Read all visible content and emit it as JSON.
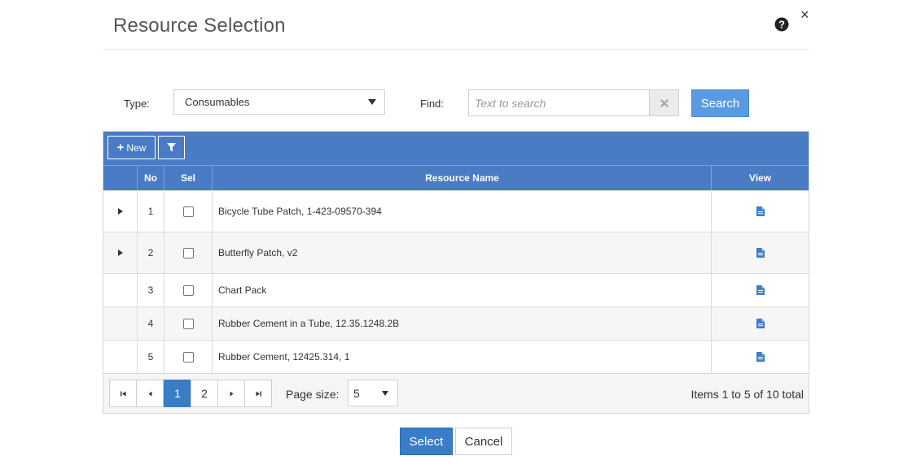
{
  "dialog": {
    "title": "Resource Selection",
    "help_icon": "question-circle-icon",
    "close_icon": "close-icon",
    "close_glyph": "×"
  },
  "filters": {
    "type_label": "Type:",
    "type_value": "Consumables",
    "find_label": "Find:",
    "search_placeholder": "Text to search",
    "search_value": "",
    "clear_icon": "clear-x-icon",
    "search_label": "Search"
  },
  "toolbar": {
    "new_label": "New",
    "new_icon": "plus-icon",
    "filter_icon": "filter-icon"
  },
  "grid": {
    "columns": [
      "",
      "No",
      "Sel",
      "Resource Name",
      "View"
    ],
    "rows": [
      {
        "no": "1",
        "name": "Bicycle Tube Patch, 1-423-09570-394",
        "expandable": true,
        "checked": false
      },
      {
        "no": "2",
        "name": "Butterfly Patch, v2",
        "expandable": true,
        "checked": false
      },
      {
        "no": "3",
        "name": "Chart Pack",
        "expandable": false,
        "checked": false
      },
      {
        "no": "4",
        "name": "Rubber Cement in a Tube, 12.35.1248.2B",
        "expandable": false,
        "checked": false
      },
      {
        "no": "5",
        "name": "Rubber Cement, 12425.314, 1",
        "expandable": false,
        "checked": false
      }
    ],
    "view_icon": "document-icon"
  },
  "pager": {
    "pages": [
      "1",
      "2"
    ],
    "current_page": "1",
    "page_size_label": "Page size:",
    "page_size": "5",
    "info": "Items 1 to 5 of 10 total"
  },
  "actions": {
    "select_label": "Select",
    "cancel_label": "Cancel"
  },
  "colors": {
    "header_blue": "#4a7bc5",
    "primary_blue": "#3a7cc6",
    "search_blue": "#5b9ae0",
    "icon_blue": "#3f7dc4"
  }
}
